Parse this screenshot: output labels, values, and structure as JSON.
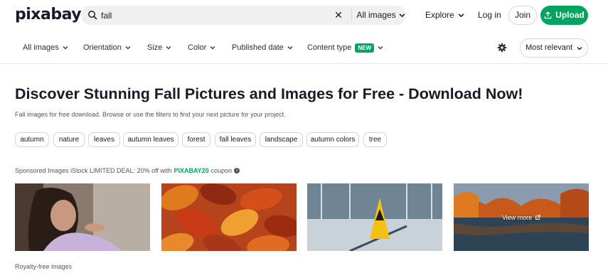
{
  "header": {
    "logo": "pixabay",
    "search_value": "fall",
    "search_type": "All images",
    "explore": "Explore",
    "login": "Log in",
    "join": "Join",
    "upload": "Upload"
  },
  "filters": [
    {
      "label": "All images"
    },
    {
      "label": "Orientation"
    },
    {
      "label": "Size"
    },
    {
      "label": "Color"
    },
    {
      "label": "Published date"
    },
    {
      "label": "Content type",
      "badge": "NEW"
    }
  ],
  "sort": "Most relevant",
  "title": "Discover Stunning Fall Pictures and Images for Free - Download Now!",
  "subtitle": "Fall images for free download. Browse or use the filters to find your next picture for your project.",
  "tags": [
    "autumn",
    "nature",
    "leaves",
    "autumn leaves",
    "forest",
    "fall leaves",
    "landscape",
    "autumn colors",
    "tree"
  ],
  "sponsored": {
    "prefix": "Sponsored Images iStock LIMITED DEAL: 20% off with",
    "code": "PIXABAY20",
    "suffix": "coupon"
  },
  "images": [
    {
      "subject": "woman-blowing-hand"
    },
    {
      "subject": "autumn-leaves"
    },
    {
      "subject": "wet-floor-sign"
    },
    {
      "subject": "autumn-lake",
      "overlay": "View more"
    }
  ],
  "royalty_label": "Royalty-free images",
  "colors": {
    "accent": "#02a35f",
    "text": "#191b26"
  }
}
